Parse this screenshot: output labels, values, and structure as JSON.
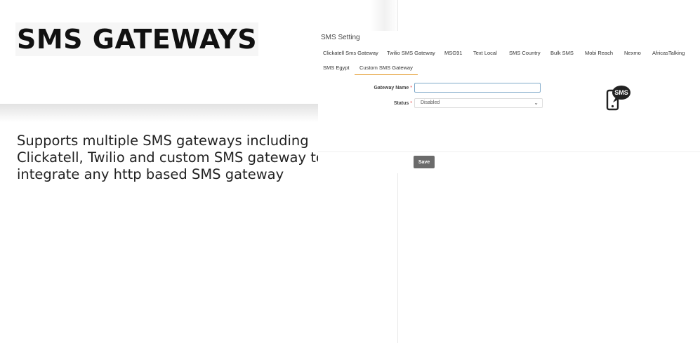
{
  "hero": {
    "title": "SMS GATEWAYS",
    "description": "Supports multiple SMS gateways including\nClickatell, Twilio and custom SMS gateway to\nintegrate any http based SMS gateway"
  },
  "settings": {
    "title": "SMS Setting",
    "tabs": [
      {
        "label": "Clickatell Sms Gateway",
        "active": false
      },
      {
        "label": "Twilio SMS Gateway",
        "active": false
      },
      {
        "label": "MSG91",
        "active": false
      },
      {
        "label": "Text Local",
        "active": false
      },
      {
        "label": "SMS Country",
        "active": false
      },
      {
        "label": "Bulk SMS",
        "active": false
      },
      {
        "label": "Mobi Reach",
        "active": false
      },
      {
        "label": "Nexmo",
        "active": false
      },
      {
        "label": "AfricasTalking",
        "active": false
      },
      {
        "label": "SMS Egypt",
        "active": false
      },
      {
        "label": "Custom SMS Gateway",
        "active": true
      }
    ],
    "form": {
      "gateway_name_label": "Gateway Name",
      "gateway_name_value": "",
      "status_label": "Status",
      "required_mark": "*",
      "status_value": "Disabled"
    },
    "icon": {
      "name": "sms-phone-icon",
      "text": "SMS"
    },
    "save_label": "Save",
    "accent_color": "#e6a23c",
    "required_color": "#e53935",
    "button_color": "#6b6b6b"
  }
}
